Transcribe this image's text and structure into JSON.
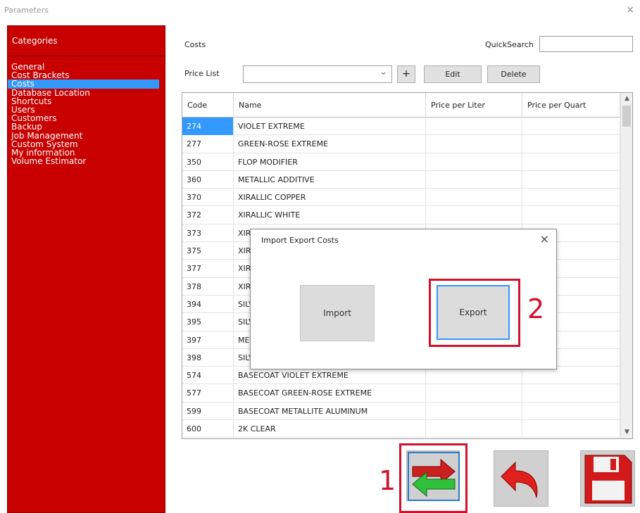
{
  "window": {
    "title": "Parameters",
    "close_glyph": "×"
  },
  "sidebar": {
    "header": "Categories",
    "items": [
      {
        "label": "General"
      },
      {
        "label": "Cost Brackets"
      },
      {
        "label": "Costs",
        "selected": true
      },
      {
        "label": "Database Location"
      },
      {
        "label": "Shortcuts"
      },
      {
        "label": "Users"
      },
      {
        "label": "Customers"
      },
      {
        "label": "Backup"
      },
      {
        "label": "Job Management"
      },
      {
        "label": "Custom System"
      },
      {
        "label": "My information"
      },
      {
        "label": "Volume Estimator"
      }
    ]
  },
  "main": {
    "section_title": "Costs",
    "quicksearch": {
      "label": "QuickSearch",
      "value": ""
    },
    "price_list": {
      "label": "Price List",
      "value": "",
      "chevron": "⌄"
    },
    "buttons": {
      "add": "+",
      "edit": "Edit",
      "delete": "Delete"
    }
  },
  "table": {
    "headers": [
      "Code",
      "Name",
      "Price per Liter",
      "Price per Quart"
    ],
    "rows": [
      {
        "code": "274",
        "name": "VIOLET EXTREME",
        "liter": "",
        "quart": "",
        "selected": true
      },
      {
        "code": "277",
        "name": "GREEN-ROSE EXTREME",
        "liter": "",
        "quart": ""
      },
      {
        "code": "350",
        "name": "FLOP MODIFIER",
        "liter": "",
        "quart": ""
      },
      {
        "code": "360",
        "name": "METALLIC ADDITIVE",
        "liter": "",
        "quart": ""
      },
      {
        "code": "370",
        "name": "XIRALLIC COPPER",
        "liter": "",
        "quart": ""
      },
      {
        "code": "372",
        "name": "XIRALLIC WHITE",
        "liter": "",
        "quart": ""
      },
      {
        "code": "373",
        "name": "XIRA",
        "liter": "",
        "quart": ""
      },
      {
        "code": "375",
        "name": "XIRA",
        "liter": "",
        "quart": ""
      },
      {
        "code": "377",
        "name": "XIRA",
        "liter": "",
        "quart": ""
      },
      {
        "code": "378",
        "name": "XIRA",
        "liter": "",
        "quart": ""
      },
      {
        "code": "394",
        "name": "SILV",
        "liter": "",
        "quart": ""
      },
      {
        "code": "395",
        "name": "SILV",
        "liter": "",
        "quart": ""
      },
      {
        "code": "397",
        "name": "META",
        "liter": "",
        "quart": ""
      },
      {
        "code": "398",
        "name": "SILV",
        "liter": "",
        "quart": ""
      },
      {
        "code": "574",
        "name": "BASECOAT VIOLET EXTREME",
        "liter": "",
        "quart": ""
      },
      {
        "code": "577",
        "name": "BASECOAT GREEN-ROSE EXTREME",
        "liter": "",
        "quart": ""
      },
      {
        "code": "599",
        "name": "BASECOAT METALLITE ALUMINUM",
        "liter": "",
        "quart": ""
      },
      {
        "code": "600",
        "name": "2K CLEAR",
        "liter": "",
        "quart": ""
      }
    ],
    "scroll_up": "▲",
    "scroll_down": "▼"
  },
  "dialog": {
    "title": "Import Export Costs",
    "close_glyph": "×",
    "import_label": "Import",
    "export_label": "Export"
  },
  "annotations": {
    "step1": "1",
    "step2": "2",
    "color": "#d3102c"
  },
  "toolbar": {
    "import_export_icon": "import-export-arrows-icon",
    "undo_icon": "undo-arrow-icon",
    "save_icon": "floppy-disk-save-icon"
  },
  "colors": {
    "sidebar_bg": "#c80000",
    "selection": "#3399ff",
    "annotation_red": "#d3102c"
  }
}
